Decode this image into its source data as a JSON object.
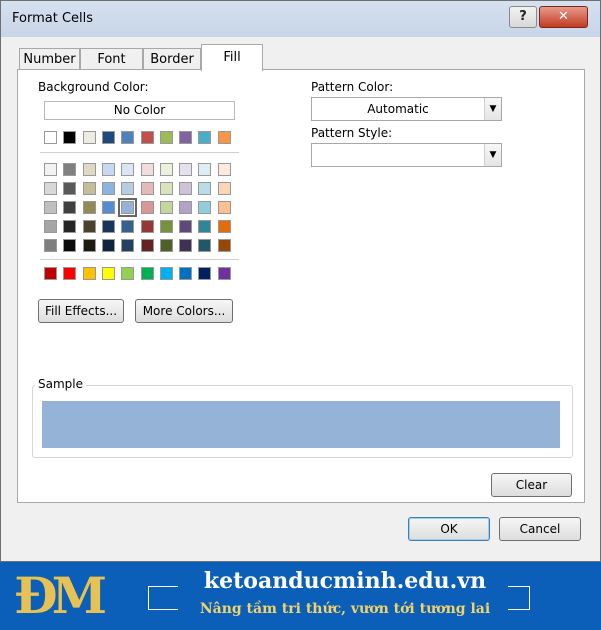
{
  "window": {
    "title": "Format Cells",
    "help": "?",
    "close": "✕"
  },
  "tabs": [
    {
      "label": "Number"
    },
    {
      "label": "Font"
    },
    {
      "label": "Border"
    },
    {
      "label": "Fill",
      "active": true
    }
  ],
  "fill": {
    "background_color_label": "Background Color:",
    "no_color_label": "No Color",
    "theme_top_row": [
      "#ffffff",
      "#000000",
      "#eeece1",
      "#1f497d",
      "#4f81bd",
      "#c0504d",
      "#9bbb59",
      "#8064a2",
      "#4bacc6",
      "#f79646"
    ],
    "theme_shades": [
      [
        "#f2f2f2",
        "#808080",
        "#ddd9c3",
        "#c6d9f0",
        "#dbe5f1",
        "#f2dcdb",
        "#ebf1dd",
        "#e5e0ec",
        "#dbeef3",
        "#fdeada"
      ],
      [
        "#d8d8d8",
        "#595959",
        "#c4bd97",
        "#8db3e2",
        "#b8cce4",
        "#e5b9b7",
        "#d7e3bc",
        "#ccc1d9",
        "#b7dde8",
        "#fbd5b5"
      ],
      [
        "#bfbfbf",
        "#3f3f3f",
        "#938953",
        "#548dd4",
        "#95b3d7",
        "#d99694",
        "#c3d69b",
        "#b2a2c7",
        "#92cddc",
        "#fac08f"
      ],
      [
        "#a5a5a5",
        "#262626",
        "#494429",
        "#17365d",
        "#366092",
        "#953734",
        "#76923c",
        "#5f497a",
        "#31859b",
        "#e36c09"
      ],
      [
        "#7f7f7f",
        "#0c0c0c",
        "#1d1b10",
        "#0f243e",
        "#244061",
        "#632423",
        "#4f6128",
        "#3f3151",
        "#205867",
        "#974806"
      ]
    ],
    "standard_colors": [
      "#c00000",
      "#ff0000",
      "#ffc000",
      "#ffff00",
      "#92d050",
      "#00b050",
      "#00b0f0",
      "#0070c0",
      "#002060",
      "#7030a0"
    ],
    "selected_color": "#95b3d7",
    "fill_effects_label": "Fill Effects...",
    "more_colors_label": "More Colors...",
    "pattern_color_label": "Pattern Color:",
    "pattern_color_value": "Automatic",
    "pattern_style_label": "Pattern Style:",
    "pattern_style_value": "",
    "sample_label": "Sample",
    "sample_color": "#95b3d7",
    "clear_label": "Clear"
  },
  "footer": {
    "ok_label": "OK",
    "cancel_label": "Cancel"
  },
  "banner": {
    "logo_text": "ĐM",
    "site": "ketoanducminh.edu.vn",
    "slogan": "Nâng tầm tri thức, vươn tới tương lai",
    "background": "#0b5fb8"
  }
}
